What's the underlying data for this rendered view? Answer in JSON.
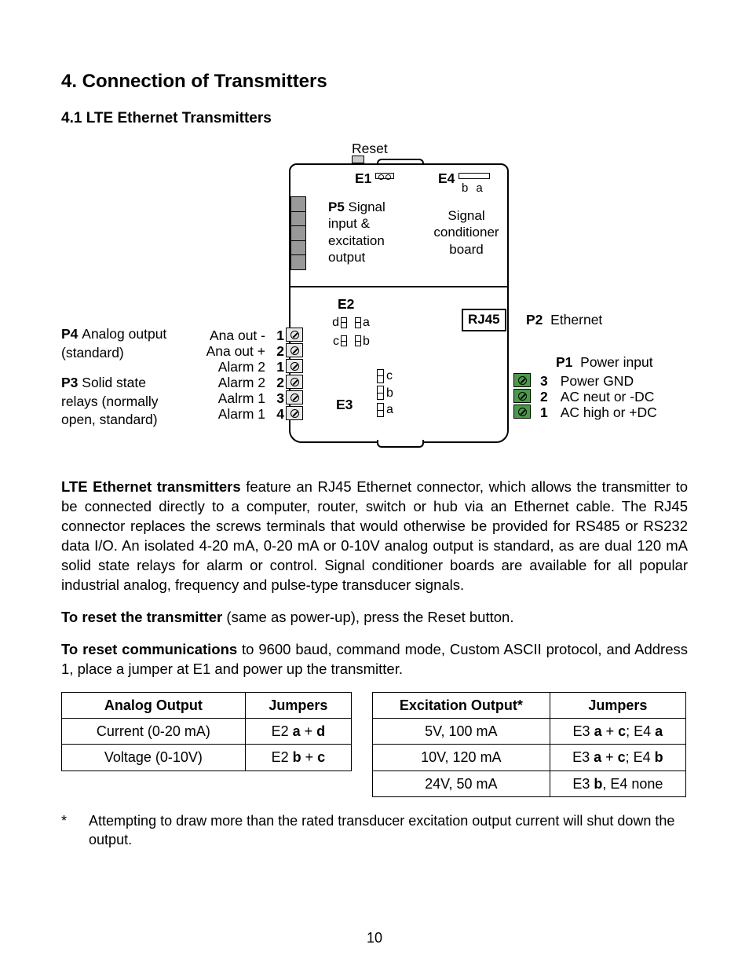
{
  "heading": "4.   Connection of Transmitters",
  "subheading": "4.1  LTE Ethernet Transmitters",
  "diagram": {
    "reset": "Reset",
    "e1": "E1",
    "e4": "E4",
    "e4_sub_b": "b",
    "e4_sub_a": "a",
    "p5_label": "P5",
    "p5_text": "Signal input & excitation output",
    "sig_board": "Signal conditioner board",
    "e2": "E2",
    "e2_d": "d",
    "e2_a": "a",
    "e2_c": "c",
    "e2_b": "b",
    "e3": "E3",
    "e3_c": "c",
    "e3_b": "b",
    "e3_a": "a",
    "rj45": "RJ45",
    "p4_label": "P4",
    "p4_text": "Analog output (standard)",
    "p3_label": "P3",
    "p3_text": "Solid state relays (normally open, standard)",
    "left_terms": [
      {
        "name": "Ana out -",
        "num": "1"
      },
      {
        "name": "Ana out +",
        "num": "2"
      },
      {
        "name": "Alarm 2",
        "num": "1"
      },
      {
        "name": "Alarm 2",
        "num": "2"
      },
      {
        "name": "Aalrm 1",
        "num": "3"
      },
      {
        "name": "Alarm 1",
        "num": "4"
      }
    ],
    "p2_label": "P2",
    "p2_text": "Ethernet",
    "p1_label": "P1",
    "p1_text": "Power input",
    "p1_lines": [
      {
        "num": "3",
        "text": "Power GND"
      },
      {
        "num": "2",
        "text": "AC neut or -DC"
      },
      {
        "num": "1",
        "text": "AC high or +DC"
      }
    ]
  },
  "para1_bold": "LTE Ethernet transmitters",
  "para1": " feature an RJ45 Ethernet connector, which allows the transmitter to be connected directly to a computer, router, switch or hub via an Ethernet cable. The RJ45 connector replaces the screws terminals that would otherwise be provided for RS485 or RS232 data I/O. An isolated 4-20 mA, 0-20 mA or 0-10V analog output is standard, as are dual 120 mA solid state relays for alarm or control. Signal conditioner boards are available for all popular industrial analog, frequency and pulse-type transducer signals.",
  "para2_bold": "To reset the transmitter",
  "para2": " (same as power-up), press the Reset button.",
  "para3_bold": "To reset communications",
  "para3": " to 9600 baud, command mode, Custom ASCII protocol, and Address 1, place a jumper at E1 and power up the transmitter.",
  "table_analog": {
    "h1": "Analog Output",
    "h2": "Jumpers",
    "rows": [
      {
        "c1": "Current (0-20 mA)",
        "c2_pre": "E2 ",
        "c2_b1": "a",
        "c2_mid": " + ",
        "c2_b2": "d"
      },
      {
        "c1": "Voltage (0-10V)",
        "c2_pre": "E2 ",
        "c2_b1": "b",
        "c2_mid": " + ",
        "c2_b2": "c"
      }
    ]
  },
  "table_exc": {
    "h1": "Excitation Output*",
    "h2": "Jumpers",
    "rows": [
      {
        "c1": "5V, 100 mA",
        "c2": "E3 <b>a</b> + <b>c</b>; E4 <b>a</b>"
      },
      {
        "c1": "10V, 120 mA",
        "c2": "E3 <b>a</b> + <b>c</b>; E4 <b>b</b>"
      },
      {
        "c1": "24V, 50 mA",
        "c2": "E3 <b>b</b>, E4 none"
      }
    ]
  },
  "footnote_star": "*",
  "footnote": "Attempting to draw more than the rated transducer excitation output current will shut down the output.",
  "pagenum": "10"
}
